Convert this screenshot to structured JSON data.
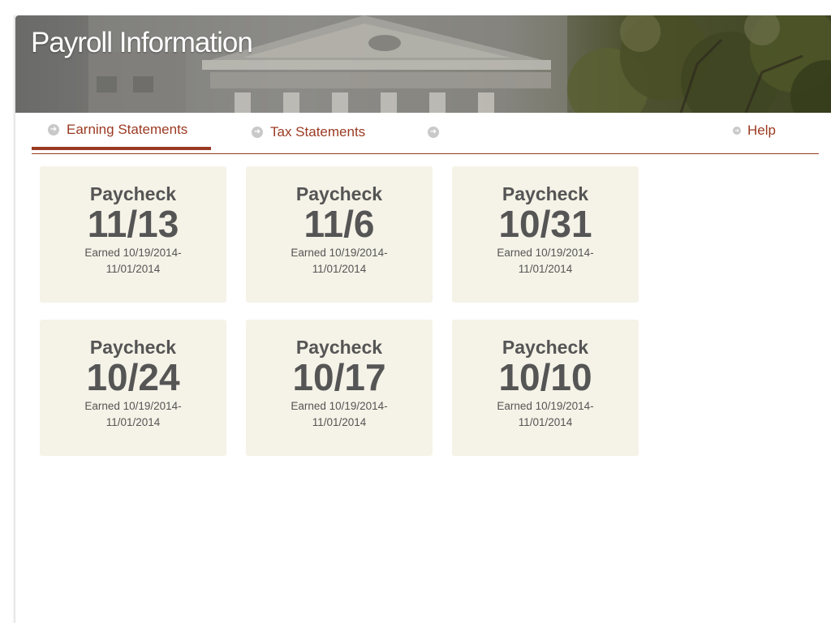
{
  "header": {
    "title": "Payroll Information"
  },
  "tabs": {
    "earning_label": "Earning Statements",
    "tax_label": "Tax Statements",
    "help_label": "Help"
  },
  "cards": [
    {
      "label": "Paycheck",
      "date": "11/13",
      "earned": "Earned 10/19/2014-11/01/2014"
    },
    {
      "label": "Paycheck",
      "date": "11/6",
      "earned": "Earned 10/19/2014-11/01/2014"
    },
    {
      "label": "Paycheck",
      "date": "10/31",
      "earned": "Earned 10/19/2014-11/01/2014"
    },
    {
      "label": "Paycheck",
      "date": "10/24",
      "earned": "Earned 10/19/2014-11/01/2014"
    },
    {
      "label": "Paycheck",
      "date": "10/17",
      "earned": "Earned 10/19/2014-11/01/2014"
    },
    {
      "label": "Paycheck",
      "date": "10/10",
      "earned": "Earned 10/19/2014-11/01/2014"
    }
  ],
  "colors": {
    "accent": "#9a3a22",
    "card_bg": "#f5f2e7",
    "card_text": "#555555",
    "icon_gray": "#c9c9c9"
  },
  "icons": {
    "tab_arrow": "arrow-circle-right-icon",
    "help": "arrow-circle-right-icon"
  }
}
